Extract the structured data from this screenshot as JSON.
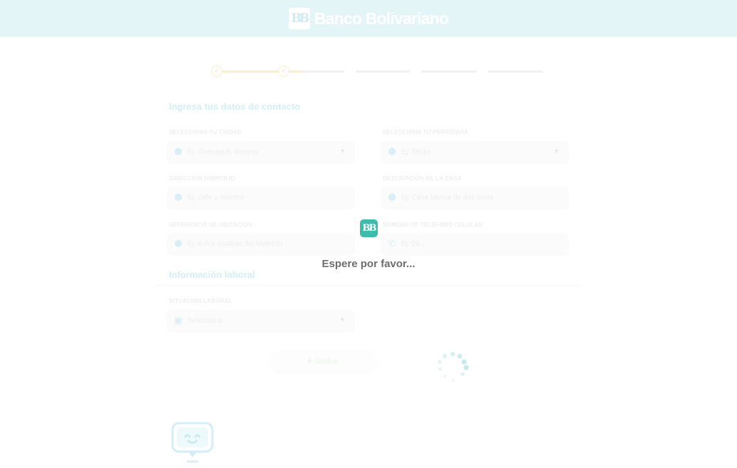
{
  "header": {
    "brand_mark": "BB",
    "brand_name": "Banco Bolivariano"
  },
  "form": {
    "title": "Ingresa tus datos de contacto",
    "fields": [
      {
        "label": "SELECCIONA TU CIUDAD",
        "placeholder": "Ej: Guayaquil, Guayas",
        "icon": "map-pin-icon",
        "dropdown": true
      },
      {
        "label": "SELECCIONA TU PARROQUIA",
        "placeholder": "Ej: Tarqui",
        "icon": "map-pin-icon",
        "dropdown": true
      },
      {
        "label": "DIRECCIÓN DOMICILIO",
        "placeholder": "Ej: calle y número",
        "icon": "map-pin-icon",
        "dropdown": false
      },
      {
        "label": "DESCRIPCIÓN DE LA CASA",
        "placeholder": "Ej: Casa blanca de dos pisos",
        "icon": "map-pin-icon",
        "dropdown": false
      },
      {
        "label": "REFERENCIA DE UBICACIÓN",
        "placeholder": "Ej: A dos cuadras del Malecón",
        "icon": "map-pin-icon",
        "dropdown": false
      },
      {
        "label": "NÚMERO DE TELÉFONO CELULAR",
        "placeholder": "Ej: 09...",
        "icon": "phone-icon",
        "dropdown": false
      }
    ]
  },
  "work": {
    "title": "Información laboral",
    "field": {
      "label": "SITUACIÓN LABORAL",
      "placeholder": "Selecciona",
      "icon": "briefcase-icon",
      "dropdown": true
    }
  },
  "save_button": {
    "label": "Grabar"
  },
  "loader": {
    "logo": "BB",
    "text": "Espere por favor..."
  },
  "progress": {
    "steps_total": 5,
    "steps_completed": 2
  },
  "colors": {
    "header_bg": "#e4f5f8",
    "loader_accent": "#3dbcad",
    "progress_done": "#fbeec9"
  }
}
